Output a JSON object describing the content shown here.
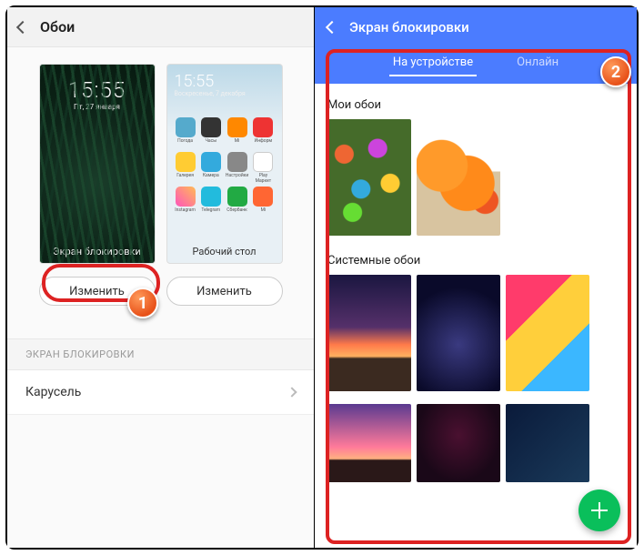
{
  "left": {
    "title": "Обои",
    "lock": {
      "time": "15:55",
      "date": "Пт, 27 января",
      "label": "Экран блокировки",
      "button": "Изменить"
    },
    "home": {
      "time": "15:55",
      "date": "Воскресенье, 7 декабря",
      "label": "Рабочий стол",
      "button": "Изменить",
      "apps": [
        "Погода",
        "Часы",
        "Mi",
        "Информ",
        "Галерея",
        "Камера",
        "Настройки",
        "Play Маркет",
        "Instagram",
        "Telegram",
        "Сбербанк",
        "Mi"
      ]
    },
    "section_header": "ЭКРАН БЛОКИРОВКИ",
    "carousel": "Карусель"
  },
  "right": {
    "title": "Экран блокировки",
    "tabs": {
      "device": "На устройстве",
      "online": "Онлайн"
    },
    "group1": "Мои обои",
    "group2": "Системные обои"
  },
  "annotations": {
    "n1": "1",
    "n2": "2"
  }
}
